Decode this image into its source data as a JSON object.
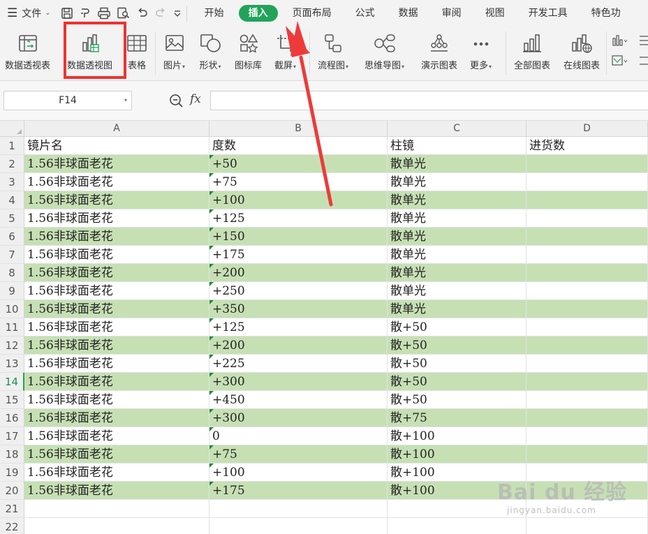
{
  "menu": {
    "file_label": "文件",
    "tabs": [
      {
        "label": "开始",
        "active": false
      },
      {
        "label": "插入",
        "active": true
      },
      {
        "label": "页面布局",
        "active": false
      },
      {
        "label": "公式",
        "active": false
      },
      {
        "label": "数据",
        "active": false
      },
      {
        "label": "审阅",
        "active": false
      },
      {
        "label": "视图",
        "active": false
      },
      {
        "label": "开发工具",
        "active": false
      },
      {
        "label": "特色功",
        "active": false
      }
    ]
  },
  "ribbon": {
    "pivot_table": "数据透视表",
    "pivot_chart": "数据透视图",
    "table": "表格",
    "picture": "图片",
    "shape": "形状",
    "icon_lib": "图标库",
    "screenshot": "截屏",
    "flowchart": "流程图",
    "mindmap": "思维导图",
    "demo_chart": "演示图表",
    "more": "更多",
    "all_charts": "全部图表",
    "online_chart": "在线图表"
  },
  "formula_bar": {
    "name_box": "F14",
    "fx": "fx",
    "formula": ""
  },
  "sheet": {
    "columns": [
      "A",
      "B",
      "C",
      "D"
    ],
    "row_numbers": [
      "1",
      "2",
      "3",
      "4",
      "5",
      "6",
      "7",
      "8",
      "9",
      "10",
      "11",
      "12",
      "13",
      "14",
      "15",
      "16",
      "17",
      "18",
      "19",
      "20",
      "21",
      "22"
    ],
    "selected_row": "14",
    "rows": [
      [
        "镜片名",
        "度数",
        "柱镜",
        "进货数"
      ],
      [
        "1.56非球面老花",
        "+50",
        "散单光",
        ""
      ],
      [
        "1.56非球面老花",
        "+75",
        "散单光",
        ""
      ],
      [
        "1.56非球面老花",
        "+100",
        "散单光",
        ""
      ],
      [
        "1.56非球面老花",
        "+125",
        "散单光",
        ""
      ],
      [
        "1.56非球面老花",
        "+150",
        "散单光",
        ""
      ],
      [
        "1.56非球面老花",
        "+175",
        "散单光",
        ""
      ],
      [
        "1.56非球面老花",
        "+200",
        "散单光",
        ""
      ],
      [
        "1.56非球面老花",
        "+250",
        "散单光",
        ""
      ],
      [
        "1.56非球面老花",
        "+350",
        "散单光",
        ""
      ],
      [
        "1.56非球面老花",
        "+125",
        "散+50",
        ""
      ],
      [
        "1.56非球面老花",
        "+200",
        "散+50",
        ""
      ],
      [
        "1.56非球面老花",
        "+225",
        "散+50",
        ""
      ],
      [
        "1.56非球面老花",
        "+300",
        "散+50",
        ""
      ],
      [
        "1.56非球面老花",
        "+450",
        "散+50",
        ""
      ],
      [
        "1.56非球面老花",
        "+300",
        "散+75",
        ""
      ],
      [
        "1.56非球面老花",
        "0",
        "散+100",
        ""
      ],
      [
        "1.56非球面老花",
        "+75",
        "散+100",
        ""
      ],
      [
        "1.56非球面老花",
        "+100",
        "散+100",
        ""
      ],
      [
        "1.56非球面老花",
        "+175",
        "散+100",
        ""
      ],
      [
        "",
        "",
        "",
        ""
      ],
      [
        "",
        "",
        "",
        ""
      ]
    ]
  },
  "watermark": {
    "main": "Bai du 经验",
    "sub": "jingyan.baidu.com"
  },
  "colors": {
    "accent": "#22a35a",
    "band": "#c6e0b4",
    "highlight": "#f03131"
  }
}
